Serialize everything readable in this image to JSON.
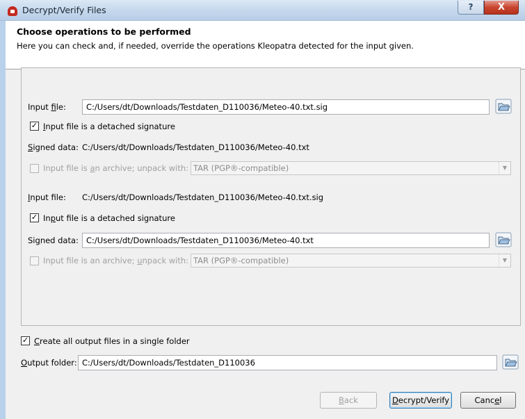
{
  "window": {
    "title": "Decrypt/Verify Files",
    "help_label": "?",
    "close_label": "X"
  },
  "header": {
    "title": "Choose operations to be performed",
    "subtitle": "Here you can check and, if needed, override the operations Kleopatra detected for the input given."
  },
  "entry1": {
    "input_label_pre": "Input ",
    "input_label_u": "f",
    "input_label_post": "ile:",
    "input_value": "C:/Users/dt/Downloads/Testdaten_D110036/Meteo-40.txt.sig",
    "detached_checked": "✓",
    "detached_label_u": "I",
    "detached_label_post": "nput file is a detached signature",
    "signed_label_u": "S",
    "signed_label_post": "igned data:",
    "signed_value": "C:/Users/dt/Downloads/Testdaten_D110036/Meteo-40.txt",
    "archive_label_pre": "Input file is ",
    "archive_label_u": "a",
    "archive_label_post": "n archive; unpack with:",
    "archive_combo": "TAR (PGP®-compatible)"
  },
  "entry2": {
    "input_label_u": "I",
    "input_label_post": "nput file:",
    "input_value": "C:/Users/dt/Downloads/Testdaten_D110036/Meteo-40.txt.sig",
    "detached_checked": "✓",
    "detached_label_pre": "In",
    "detached_label_u": "p",
    "detached_label_post": "ut file is a detached signature",
    "signed_label_pre": "Si",
    "signed_label_u": "g",
    "signed_label_post": "ned data:",
    "signed_value": "C:/Users/dt/Downloads/Testdaten_D110036/Meteo-40.txt",
    "archive_label_pre": "Input file is an archive; ",
    "archive_label_u": "u",
    "archive_label_post": "npack with:",
    "archive_combo": "TAR (PGP®-compatible)"
  },
  "output": {
    "single_folder_checked": "✓",
    "single_folder_label_u": "C",
    "single_folder_label_post": "reate all output files in a single folder",
    "folder_label_u": "O",
    "folder_label_post": "utput folder:",
    "folder_value": "C:/Users/dt/Downloads/Testdaten_D110036"
  },
  "buttons": {
    "back_u": "B",
    "back_post": "ack",
    "decrypt_u": "D",
    "decrypt_post": "ecrypt/Verify",
    "cancel_pre": "Canc",
    "cancel_u": "e",
    "cancel_post": "l"
  },
  "colors": {
    "accent_default_button": "#3c7fb1",
    "close_button": "#c8452f",
    "app_icon": "#c42a1f"
  },
  "icons": {
    "app": "kleopatra-icon",
    "folder": "open-folder-icon",
    "dropdown": "chevron-down-icon"
  }
}
